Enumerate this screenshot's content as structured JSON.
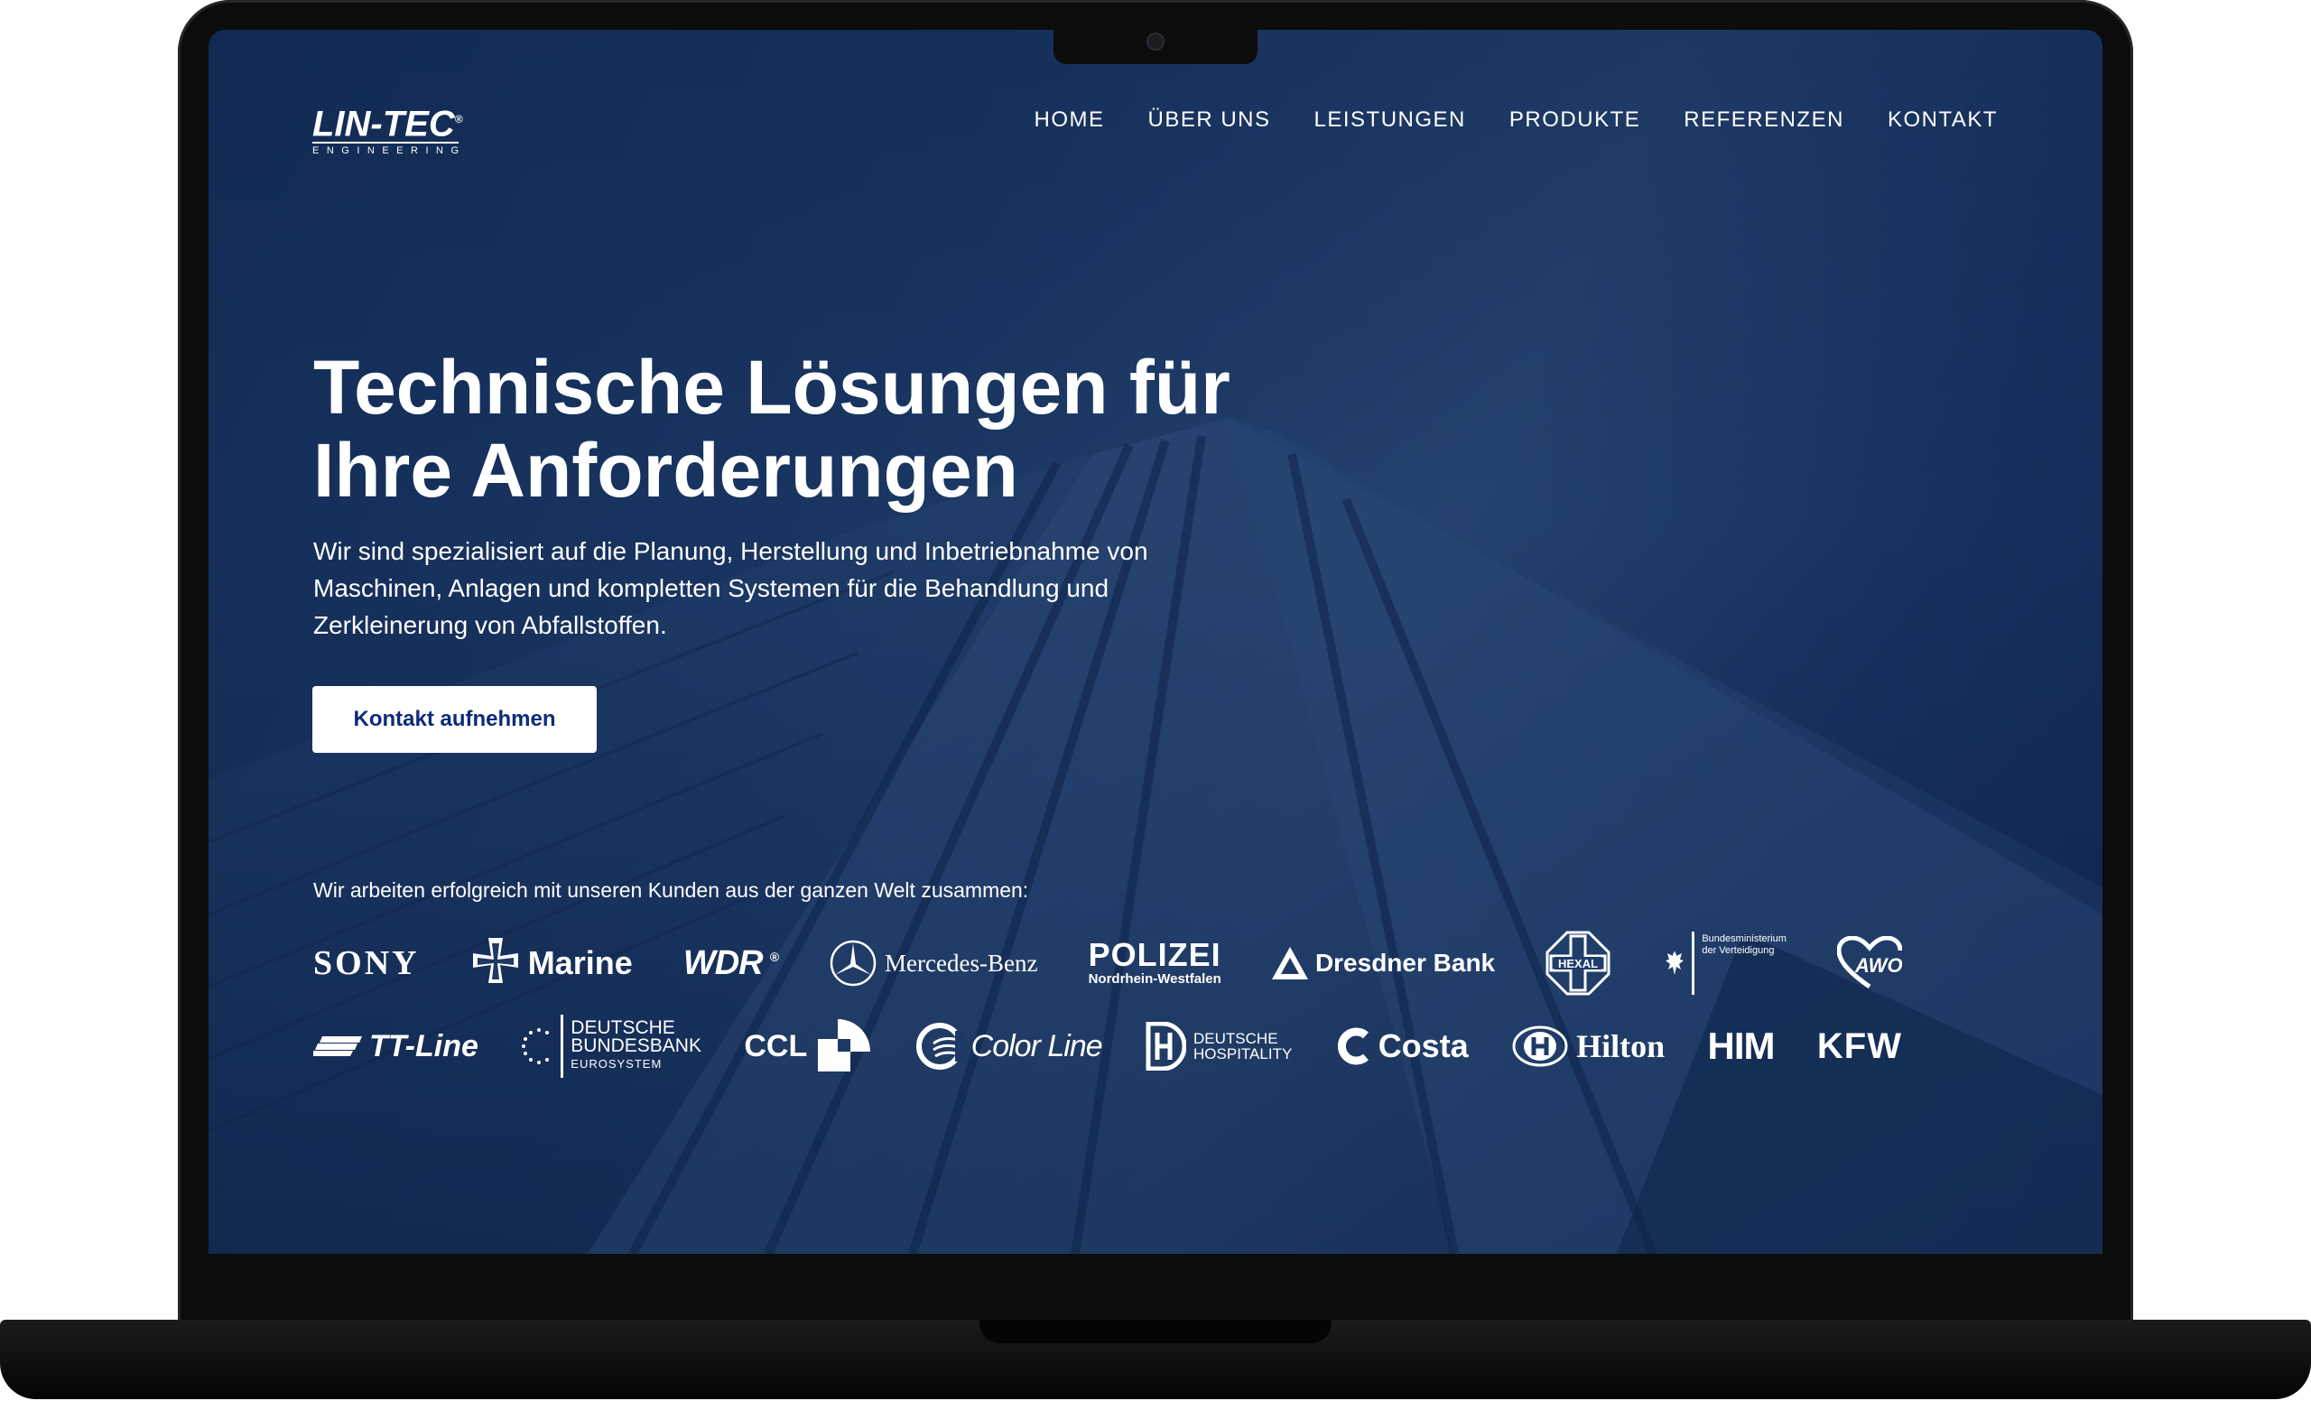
{
  "site": {
    "logo": {
      "name": "LIN-TEC",
      "sub": "ENGINEERING",
      "reg": "®"
    }
  },
  "nav": {
    "items": [
      {
        "label": "HOME"
      },
      {
        "label": "ÜBER UNS"
      },
      {
        "label": "LEISTUNGEN"
      },
      {
        "label": "PRODUKTE"
      },
      {
        "label": "REFERENZEN"
      },
      {
        "label": "KONTAKT"
      }
    ]
  },
  "hero": {
    "title_line1": "Technische Lösungen für",
    "title_line2": "Ihre Anforderungen",
    "text": "Wir sind spezialisiert auf die Planung, Herstellung und Inbetriebnahme von Maschinen, Anlagen und kompletten Systemen für die Behandlung und Zerkleinerung von Abfallstoffen.",
    "cta_label": "Kontakt aufnehmen"
  },
  "clients": {
    "intro": "Wir arbeiten erfolgreich mit unseren Kunden aus der ganzen Welt zusammen:",
    "row1": {
      "sony": "SONY",
      "marine": "Marine",
      "wdr": "WDR",
      "mercedes": "Mercedes-Benz",
      "polizei": "POLIZEI",
      "polizei_sub": "Nordrhein-Westfalen",
      "dresdner": "Dresdner Bank",
      "hexal": "HEXAL",
      "bmvg_line1": "Bundesministerium",
      "bmvg_line2": "der Verteidigung",
      "awo": "AWO"
    },
    "row2": {
      "ttline": "TT-Line",
      "dbb_line1": "DEUTSCHE",
      "dbb_line2": "BUNDESBANK",
      "dbb_line3": "EUROSYSTEM",
      "ccl": "CCL",
      "colorline": "Color Line",
      "dh_line1": "DEUTSCHE",
      "dh_line2": "HOSPITALITY",
      "costa": "Costa",
      "hilton": "Hilton",
      "him": "HIM",
      "kfw": "KFW"
    }
  },
  "colors": {
    "hero_bg": "#1d3a66",
    "cta_text": "#0d2a7a",
    "device": "#0c0c0c"
  }
}
